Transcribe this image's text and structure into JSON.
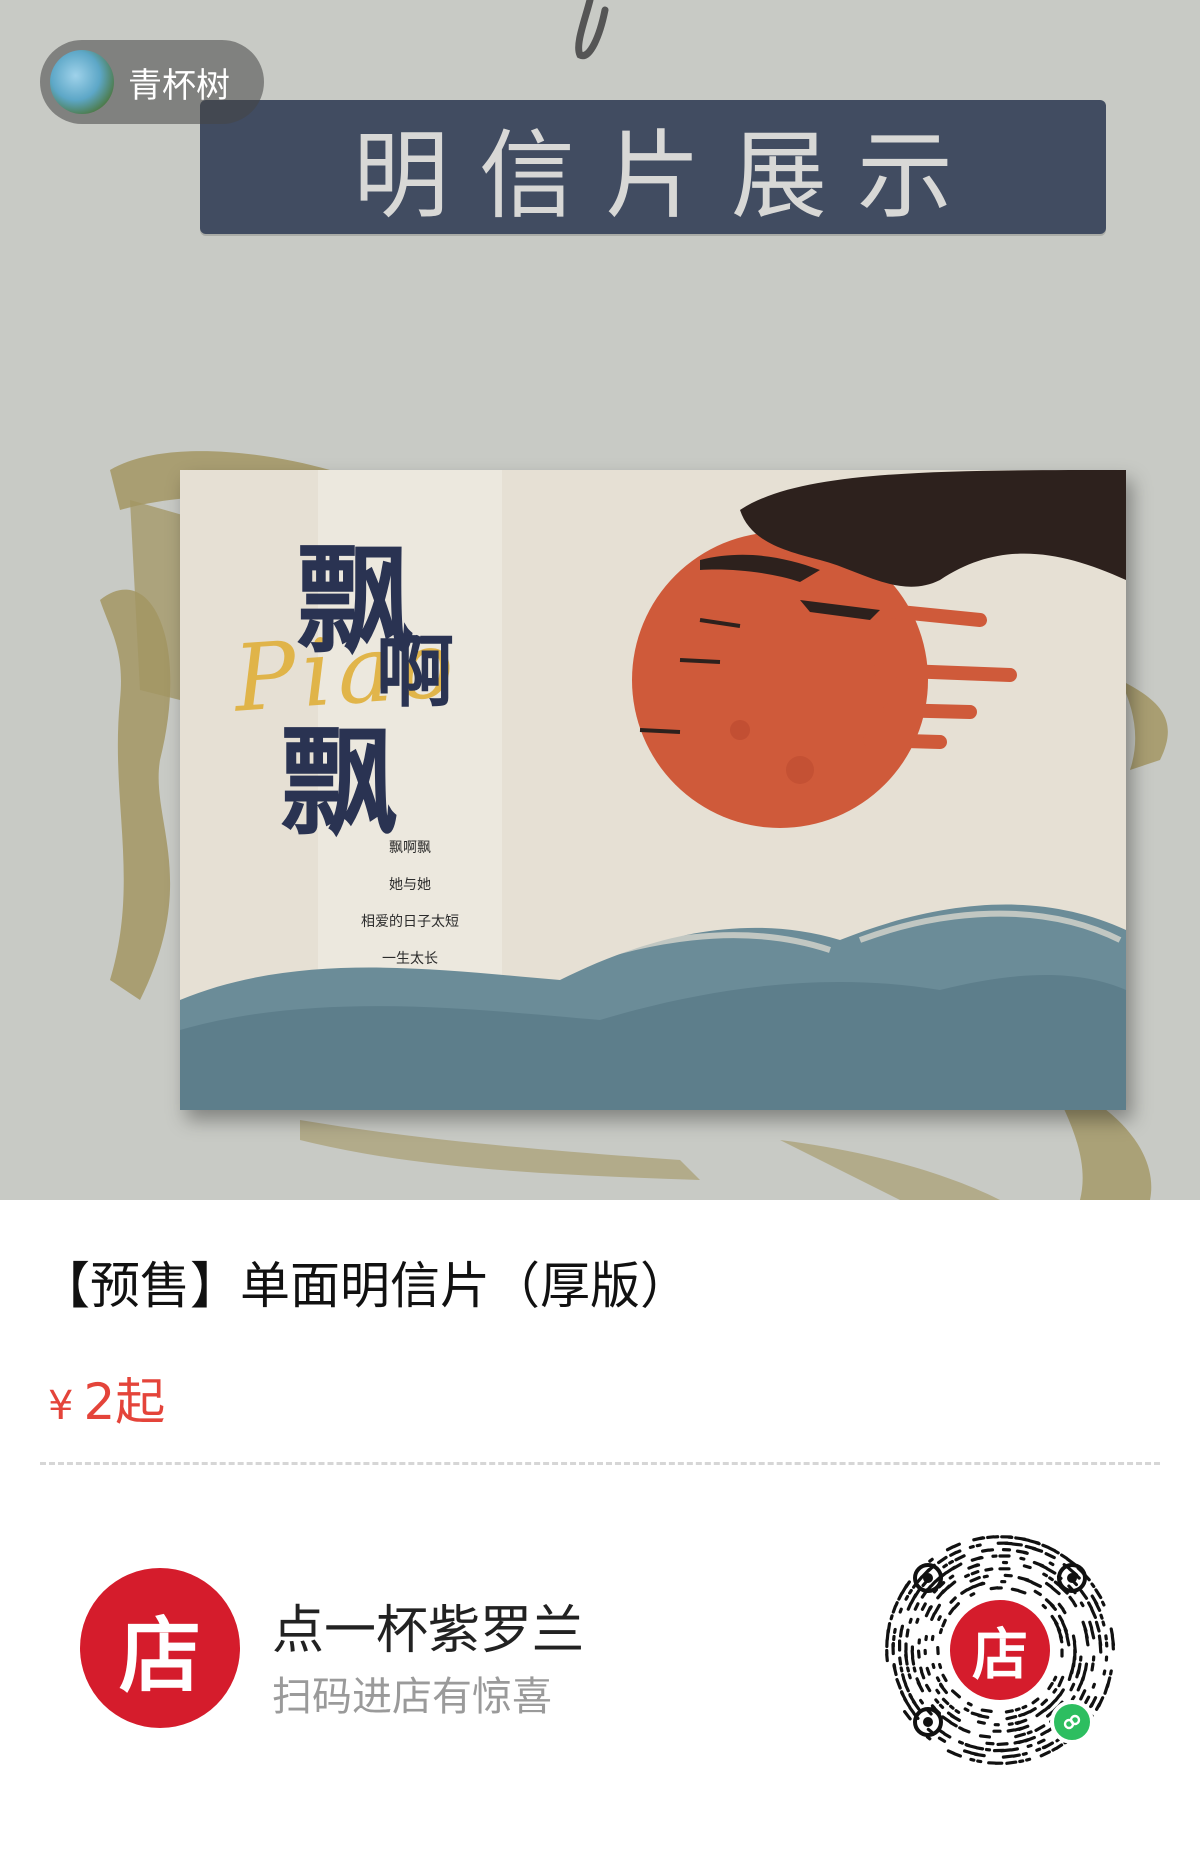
{
  "author": {
    "name": "青杯树"
  },
  "hero": {
    "banner_title": "明信片展示",
    "postcard": {
      "calligraphy_line1": "飘",
      "calligraphy_line2": "啊",
      "calligraphy_line3": "飘",
      "script_text": "Piao",
      "poem": [
        "飘啊飘",
        "她与她",
        "相爱的日子太短",
        "一生太长"
      ]
    }
  },
  "product": {
    "title": "【预售】单面明信片（厚版）",
    "currency": "¥",
    "price": "2起"
  },
  "shop": {
    "logo_char": "店",
    "name": "点一杯紫罗兰",
    "tagline": "扫码进店有惊喜"
  },
  "qr": {
    "center_char": "店"
  },
  "colors": {
    "hero_bg": "#c8cac5",
    "banner_bg": "#414c61",
    "price": "#e4443a",
    "shop_red": "#d51c2c",
    "wechat_green": "#2dbe60"
  }
}
